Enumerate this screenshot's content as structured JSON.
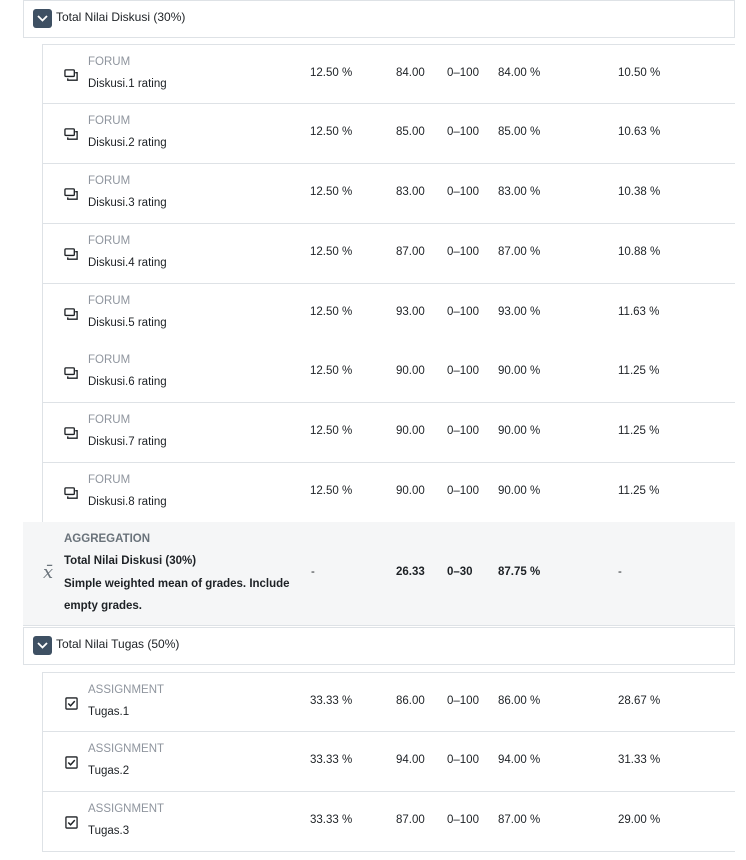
{
  "categories": [
    {
      "title": "Total Nilai Diskusi (30%)",
      "items": [
        {
          "type": "FORUM",
          "name": "Diskusi.1 rating",
          "weight": "12.50 %",
          "grade": "84.00",
          "range": "0–100",
          "percentage": "84.00 %",
          "contribution": "10.50 %"
        },
        {
          "type": "FORUM",
          "name": "Diskusi.2 rating",
          "weight": "12.50 %",
          "grade": "85.00",
          "range": "0–100",
          "percentage": "85.00 %",
          "contribution": "10.63 %"
        },
        {
          "type": "FORUM",
          "name": "Diskusi.3 rating",
          "weight": "12.50 %",
          "grade": "83.00",
          "range": "0–100",
          "percentage": "83.00 %",
          "contribution": "10.38 %"
        },
        {
          "type": "FORUM",
          "name": "Diskusi.4 rating",
          "weight": "12.50 %",
          "grade": "87.00",
          "range": "0–100",
          "percentage": "87.00 %",
          "contribution": "10.88 %"
        },
        {
          "type": "FORUM",
          "name": "Diskusi.5 rating",
          "weight": "12.50 %",
          "grade": "93.00",
          "range": "0–100",
          "percentage": "93.00 %",
          "contribution": "11.63 %"
        },
        {
          "type": "FORUM",
          "name": "Diskusi.6 rating",
          "weight": "12.50 %",
          "grade": "90.00",
          "range": "0–100",
          "percentage": "90.00 %",
          "contribution": "11.25 %"
        },
        {
          "type": "FORUM",
          "name": "Diskusi.7 rating",
          "weight": "12.50 %",
          "grade": "90.00",
          "range": "0–100",
          "percentage": "90.00 %",
          "contribution": "11.25 %"
        },
        {
          "type": "FORUM",
          "name": "Diskusi.8 rating",
          "weight": "12.50 %",
          "grade": "90.00",
          "range": "0–100",
          "percentage": "90.00 %",
          "contribution": "11.25 %"
        }
      ],
      "aggregation": {
        "type": "AGGREGATION",
        "name": "Total Nilai Diskusi (30%)",
        "description": "Simple weighted mean of grades. Include empty grades.",
        "weight": "-",
        "grade": "26.33",
        "range": "0–30",
        "percentage": "87.75 %",
        "contribution": "-"
      }
    },
    {
      "title": "Total Nilai Tugas (50%)",
      "items": [
        {
          "type": "ASSIGNMENT",
          "name": "Tugas.1",
          "weight": "33.33 %",
          "grade": "86.00",
          "range": "0–100",
          "percentage": "86.00 %",
          "contribution": "28.67 %"
        },
        {
          "type": "ASSIGNMENT",
          "name": "Tugas.2",
          "weight": "33.33 %",
          "grade": "94.00",
          "range": "0–100",
          "percentage": "94.00 %",
          "contribution": "31.33 %"
        },
        {
          "type": "ASSIGNMENT",
          "name": "Tugas.3",
          "weight": "33.33 %",
          "grade": "87.00",
          "range": "0–100",
          "percentage": "87.00 %",
          "contribution": "29.00 %"
        }
      ]
    }
  ],
  "icons": {
    "toggle": "chevron-down-icon",
    "forum": "forum-icon",
    "assignment": "assignment-icon",
    "aggregation": "mean-icon"
  },
  "colors": {
    "toggle_bg": "#3e5063",
    "aggregation_bg": "#f5f6f7",
    "muted_text": "#8f959e"
  }
}
